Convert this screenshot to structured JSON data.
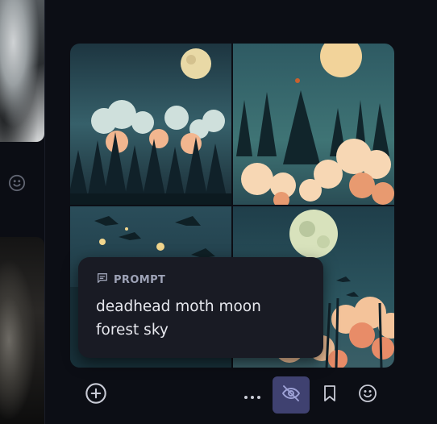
{
  "prompt": {
    "heading": "PROMPT",
    "text": "deadhead moth moon forest sky"
  },
  "icons": {
    "left_reaction": "smile-icon",
    "prompt": "message-square-icon",
    "add": "plus-circle-icon",
    "more": "more-horizontal-icon",
    "hide": "eye-off-icon",
    "bookmark": "bookmark-icon",
    "react": "smile-icon"
  },
  "colors": {
    "background": "#0c0e15",
    "card": "#191b24",
    "active_button": "#3f4170",
    "icon": "#c9cbd6"
  }
}
